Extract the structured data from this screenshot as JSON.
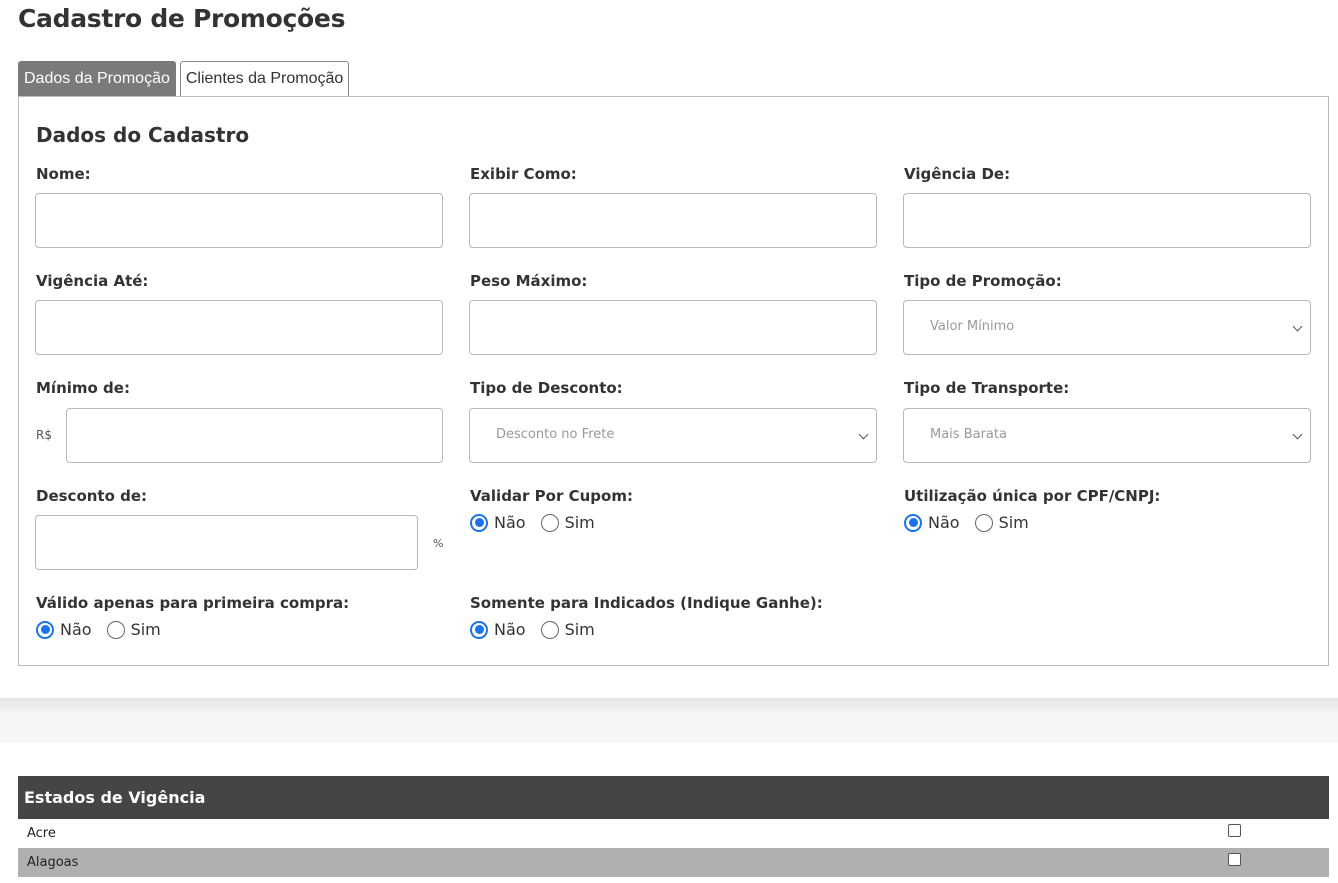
{
  "page_title": "Cadastro de Promoções",
  "tabs": [
    {
      "label": "Dados da Promoção",
      "active": true
    },
    {
      "label": "Clientes da Promoção",
      "active": false
    }
  ],
  "section_title": "Dados do Cadastro",
  "fields": {
    "nome": {
      "label": "Nome:",
      "value": ""
    },
    "exibir_como": {
      "label": "Exibir Como:",
      "value": ""
    },
    "vigencia_de": {
      "label": "Vigência De:",
      "value": ""
    },
    "vigencia_ate": {
      "label": "Vigência Até:",
      "value": ""
    },
    "peso_maximo": {
      "label": "Peso Máximo:",
      "value": ""
    },
    "tipo_promocao": {
      "label": "Tipo de Promoção:",
      "selected": "Valor Mínimo"
    },
    "minimo_de": {
      "label": "Mínimo de:",
      "prefix": "R$",
      "value": ""
    },
    "tipo_desconto": {
      "label": "Tipo de Desconto:",
      "selected": "Desconto no Frete"
    },
    "tipo_transporte": {
      "label": "Tipo de Transporte:",
      "selected": "Mais Barata"
    },
    "desconto_de": {
      "label": "Desconto de:",
      "suffix": "%",
      "value": ""
    }
  },
  "radios": {
    "validar_cupom": {
      "label": "Validar Por Cupom:",
      "options": [
        "Não",
        "Sim"
      ],
      "selected": "Não"
    },
    "utilizacao_unica": {
      "label": "Utilização única por CPF/CNPJ:",
      "options": [
        "Não",
        "Sim"
      ],
      "selected": "Não"
    },
    "primeira_compra": {
      "label": "Válido apenas para primeira compra:",
      "options": [
        "Não",
        "Sim"
      ],
      "selected": "Não"
    },
    "somente_indicados": {
      "label": "Somente para Indicados (Indique Ganhe):",
      "options": [
        "Não",
        "Sim"
      ],
      "selected": "Não"
    }
  },
  "states_table": {
    "header": "Estados de Vigência",
    "rows": [
      {
        "name": "Acre",
        "checked": false
      },
      {
        "name": "Alagoas",
        "checked": false
      }
    ]
  },
  "colors": {
    "accent": "#1a73e8",
    "header_bg": "#454545",
    "active_tab": "#7a7a7a",
    "row_alt": "#b0b0b0"
  }
}
